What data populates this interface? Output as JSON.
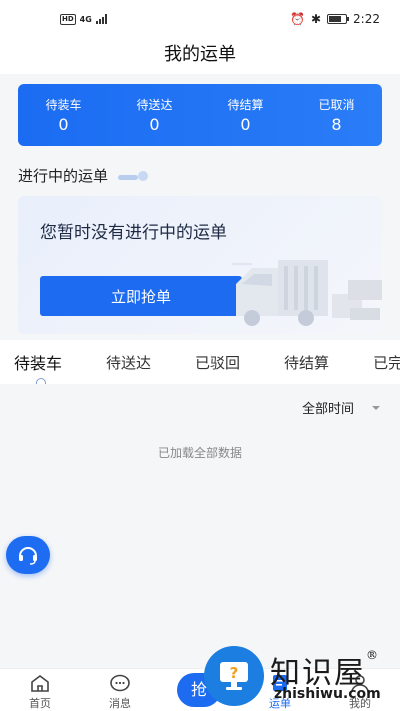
{
  "status_bar": {
    "network": "4G",
    "time": "2:22"
  },
  "header": {
    "title": "我的运单"
  },
  "summary": [
    {
      "label": "待装车",
      "count": "0"
    },
    {
      "label": "待送达",
      "count": "0"
    },
    {
      "label": "待结算",
      "count": "0"
    },
    {
      "label": "已取消",
      "count": "8"
    }
  ],
  "in_progress": {
    "title": "进行中的运单",
    "empty_text": "您暂时没有进行中的运单",
    "grab_button": "立即抢单"
  },
  "tabs": [
    "待装车",
    "待送达",
    "已驳回",
    "待结算",
    "已完"
  ],
  "active_tab": "待装车",
  "filter": {
    "label": "全部时间"
  },
  "list": {
    "loaded_text": "已加载全部数据"
  },
  "bottom_tabs": [
    {
      "label": "首页",
      "icon": "home-icon"
    },
    {
      "label": "消息",
      "icon": "message-icon"
    },
    {
      "label": "抢",
      "icon": "grab-icon"
    },
    {
      "label": "运单",
      "icon": "waybill-icon"
    },
    {
      "label": "我的",
      "icon": "profile-icon"
    }
  ],
  "watermark": {
    "title": "知识屋",
    "site": "zhishiwu.com"
  },
  "colors": {
    "primary": "#1c6bf0",
    "background": "#f5f6f8"
  }
}
